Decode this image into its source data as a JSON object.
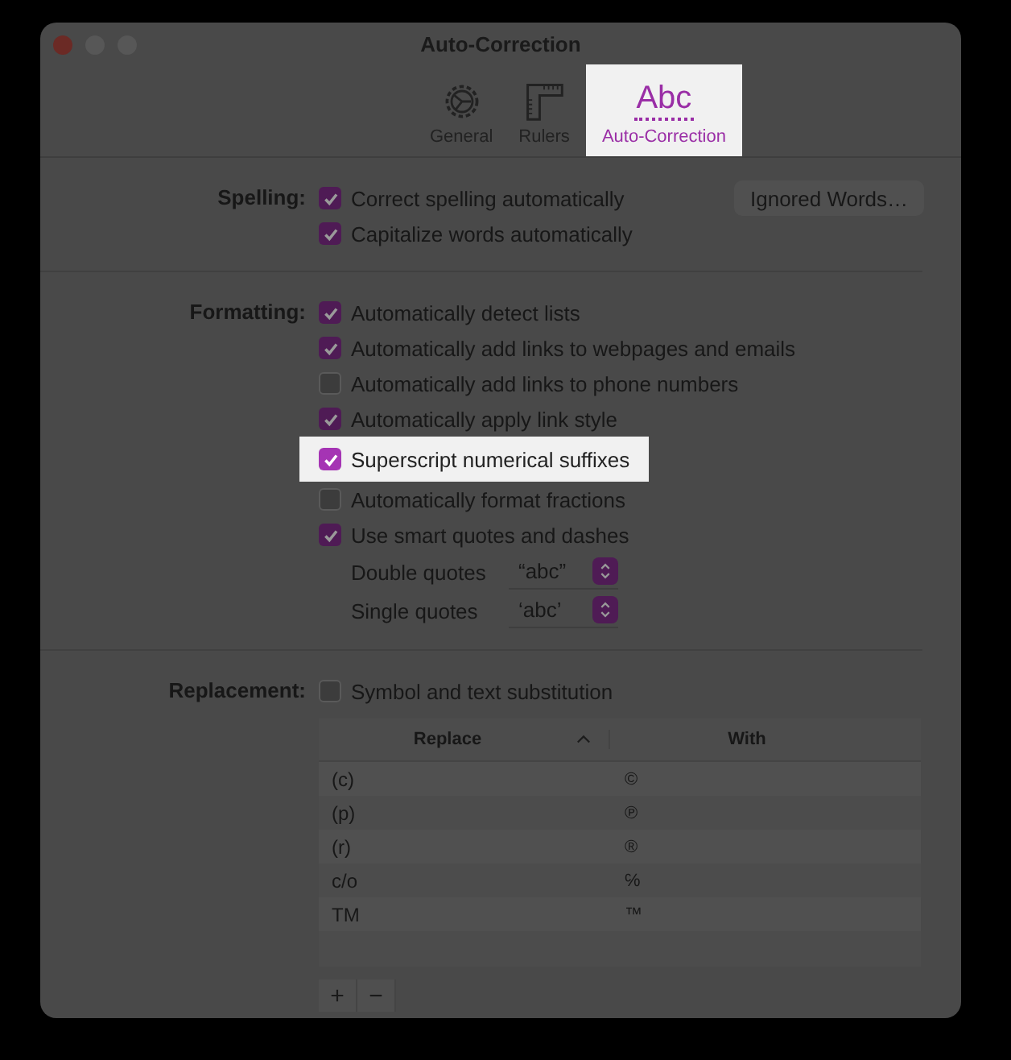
{
  "window": {
    "title": "Auto-Correction"
  },
  "toolbar": [
    {
      "kind": "gear",
      "label": "General",
      "selected": false,
      "highlighted": false
    },
    {
      "kind": "ruler",
      "label": "Rulers",
      "selected": false,
      "highlighted": false
    },
    {
      "kind": "abc",
      "glyph": "Abc",
      "label": "Auto-Correction",
      "selected": true,
      "highlighted": true
    }
  ],
  "sections": [
    {
      "label": "Spelling:",
      "button": "Ignored Words…",
      "options": [
        {
          "kind": "checkbox",
          "label": "Correct spelling automatically",
          "checked": true,
          "highlighted": false
        },
        {
          "kind": "checkbox",
          "label": "Capitalize words automatically",
          "checked": true,
          "highlighted": false
        }
      ]
    },
    {
      "label": "Formatting:",
      "options": [
        {
          "kind": "checkbox",
          "label": "Automatically detect lists",
          "checked": true,
          "highlighted": false
        },
        {
          "kind": "checkbox",
          "label": "Automatically add links to webpages and emails",
          "checked": true,
          "highlighted": false
        },
        {
          "kind": "checkbox",
          "label": "Automatically add links to phone numbers",
          "checked": false,
          "highlighted": false
        },
        {
          "kind": "checkbox",
          "label": "Automatically apply link style",
          "checked": true,
          "highlighted": false
        },
        {
          "kind": "checkbox",
          "label": "Superscript numerical suffixes",
          "checked": true,
          "highlighted": true
        },
        {
          "kind": "checkbox",
          "label": "Automatically format fractions",
          "checked": false,
          "highlighted": false
        },
        {
          "kind": "checkbox",
          "label": "Use smart quotes and dashes",
          "checked": true,
          "highlighted": false
        },
        {
          "kind": "popup",
          "label": "Double quotes",
          "value": "“abc”"
        },
        {
          "kind": "popup",
          "label": "Single quotes",
          "value": "‘abc’"
        }
      ]
    },
    {
      "label": "Replacement:",
      "options": [
        {
          "kind": "checkbox",
          "label": "Symbol and text substitution",
          "checked": false,
          "highlighted": false
        }
      ]
    }
  ],
  "table": {
    "columns": [
      "Replace",
      "With"
    ],
    "rows": [
      [
        "(c)",
        "©"
      ],
      [
        "(p)",
        "℗"
      ],
      [
        "(r)",
        "®"
      ],
      [
        "c/o",
        "℅"
      ],
      [
        "TM",
        "™"
      ]
    ],
    "buttons": [
      "+",
      "−"
    ]
  }
}
